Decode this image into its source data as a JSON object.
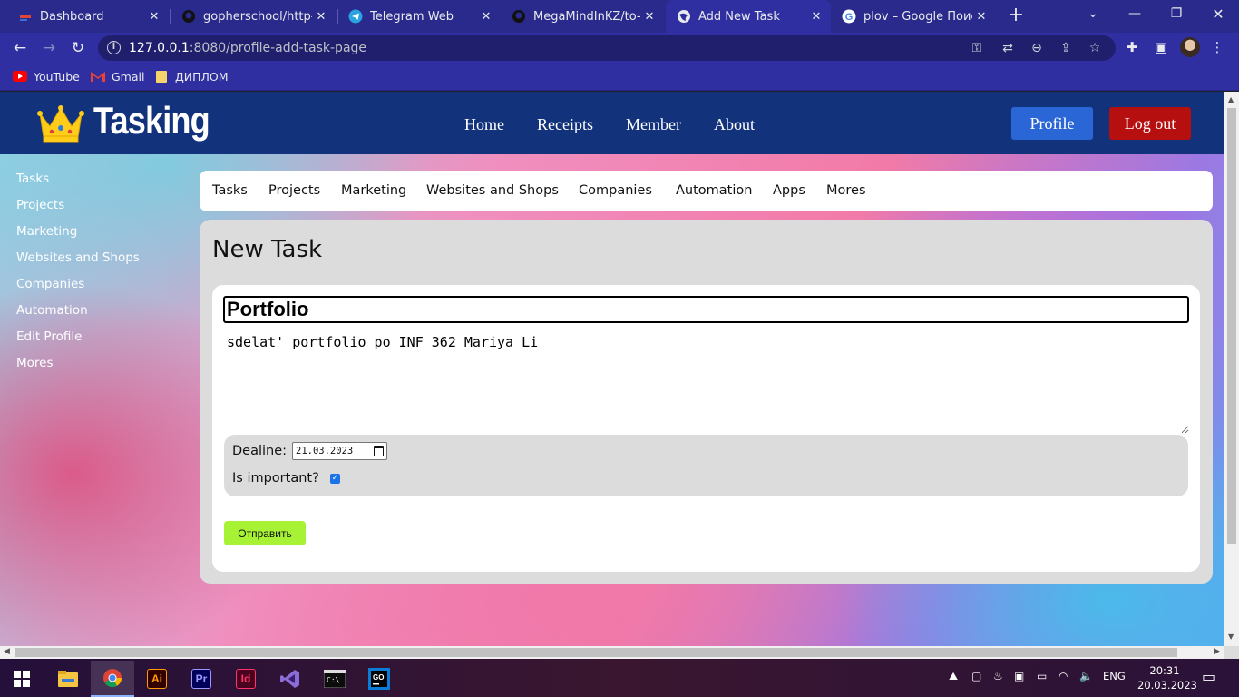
{
  "browser": {
    "tabs": [
      {
        "title": "Dashboard",
        "icon": "bars-icon"
      },
      {
        "title": "gopherschool/http-re",
        "icon": "github-icon"
      },
      {
        "title": "Telegram Web",
        "icon": "telegram-icon"
      },
      {
        "title": "MegaMindInKZ/to-do",
        "icon": "github-icon"
      },
      {
        "title": "Add New Task",
        "icon": "globe-icon",
        "active": true
      },
      {
        "title": "plov – Google Поиск",
        "icon": "google-icon"
      }
    ],
    "url_host": "127.0.0.1",
    "url_rest": ":8080/profile-add-task-page",
    "bookmarks": [
      {
        "label": "YouTube",
        "icon": "youtube-icon"
      },
      {
        "label": "Gmail",
        "icon": "gmail-icon"
      },
      {
        "label": "ДИПЛОМ",
        "icon": "folder-icon"
      }
    ]
  },
  "site": {
    "brand": "Tasking",
    "nav": [
      "Home",
      "Receipts",
      "Member",
      "About"
    ],
    "profile_label": "Profile",
    "logout_label": "Log out",
    "sidebar": [
      "Tasks",
      "Projects",
      "Marketing",
      "Websites and Shops",
      "Companies",
      "Automation",
      "Edit Profile",
      "Mores"
    ],
    "subnav": [
      "Tasks",
      "Projects",
      "Marketing",
      "Websites and Shops",
      "Companies",
      "Automation",
      "Apps",
      "Mores"
    ]
  },
  "form": {
    "heading": "New Task",
    "title_value": "Portfolio",
    "description_value": "sdelat' portfolio po INF 362 Mariya Li",
    "deadline_label": "Dealine:",
    "deadline_value": "21.03.2023",
    "important_label": "Is important?",
    "important_checked": true,
    "submit_label": "Отправить"
  },
  "taskbar": {
    "language": "ENG",
    "time": "20:31",
    "date": "20.03.2023"
  },
  "colors": {
    "header_bg": "#12327c",
    "profile_btn": "#2a66d6",
    "logout_btn": "#b50f0f",
    "submit_btn": "#a7f234",
    "browser_chrome": "#2f2fa2"
  }
}
